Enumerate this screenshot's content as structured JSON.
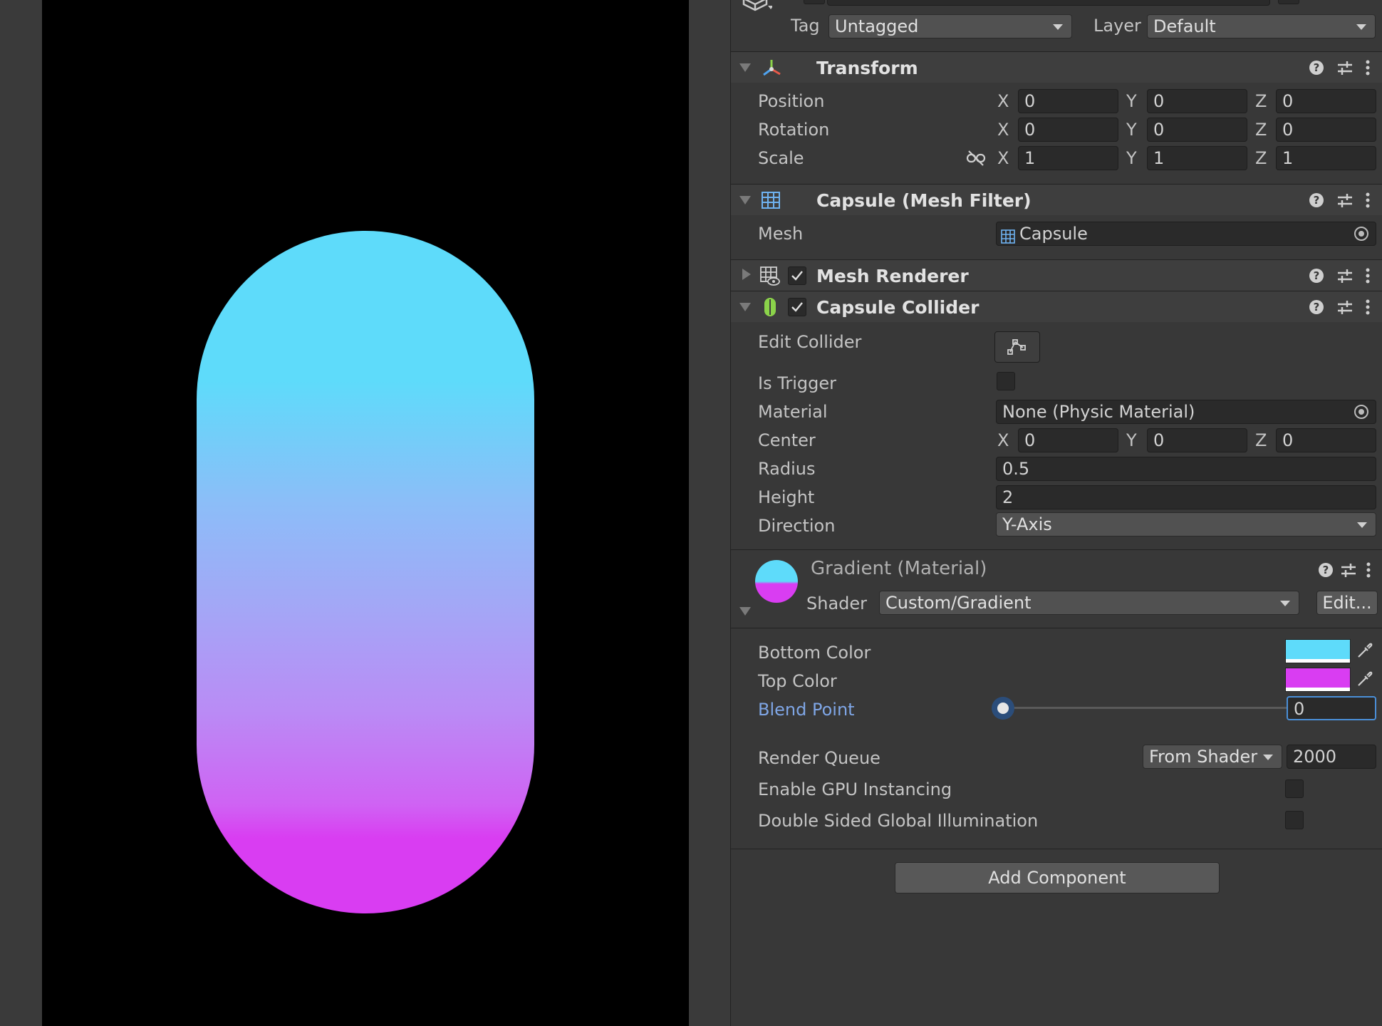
{
  "top": {
    "tag_label": "Tag",
    "tag_value": "Untagged",
    "layer_label": "Layer",
    "layer_value": "Default"
  },
  "transform": {
    "title": "Transform",
    "rows": [
      {
        "label": "Position",
        "x": "0",
        "y": "0",
        "z": "0"
      },
      {
        "label": "Rotation",
        "x": "0",
        "y": "0",
        "z": "0"
      },
      {
        "label": "Scale",
        "x": "1",
        "y": "1",
        "z": "1"
      }
    ]
  },
  "axes": {
    "x": "X",
    "y": "Y",
    "z": "Z"
  },
  "mesh_filter": {
    "title": "Capsule (Mesh Filter)",
    "mesh_label": "Mesh",
    "mesh_value": "Capsule"
  },
  "mesh_renderer": {
    "title": "Mesh Renderer"
  },
  "capsule_collider": {
    "title": "Capsule Collider",
    "edit_collider_label": "Edit Collider",
    "is_trigger_label": "Is Trigger",
    "material_label": "Material",
    "material_value": "None (Physic Material)",
    "center_label": "Center",
    "center": {
      "x": "0",
      "y": "0",
      "z": "0"
    },
    "radius_label": "Radius",
    "radius_value": "0.5",
    "height_label": "Height",
    "height_value": "2",
    "direction_label": "Direction",
    "direction_value": "Y-Axis"
  },
  "material": {
    "title": "Gradient (Material)",
    "shader_label": "Shader",
    "shader_value": "Custom/Gradient",
    "edit_button": "Edit...",
    "bottom_color_label": "Bottom Color",
    "bottom_color": "#5edbfa",
    "top_color_label": "Top Color",
    "top_color": "#d93df2",
    "blend_point_label": "Blend Point",
    "blend_point_value": "0",
    "render_queue_label": "Render Queue",
    "render_queue_mode": "From Shader",
    "render_queue_value": "2000",
    "gpu_instancing_label": "Enable GPU Instancing",
    "double_sided_gi_label": "Double Sided Global Illumination"
  },
  "add_component_button": "Add Component",
  "icons": [
    "gameobject-icon",
    "transform-icon",
    "mesh-filter-icon",
    "mesh-renderer-icon",
    "capsule-collider-icon",
    "help-icon",
    "presets-icon",
    "more-icon",
    "unlink-scale-icon",
    "edit-collider-icon",
    "object-picker-icon",
    "eyedropper-icon"
  ]
}
